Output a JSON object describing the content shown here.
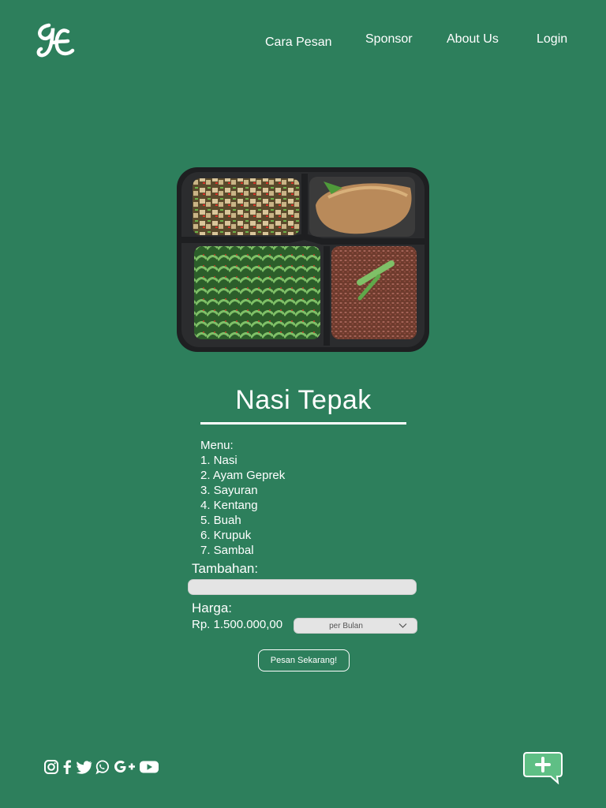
{
  "nav": {
    "items": [
      {
        "label": "Cara Pesan"
      },
      {
        "label": "Sponsor"
      },
      {
        "label": "About Us"
      },
      {
        "label": "Login"
      }
    ]
  },
  "product": {
    "title": "Nasi Tepak",
    "menu_heading": "Menu:",
    "menu_items": [
      "1. Nasi",
      "2. Ayam Geprek",
      "3. Sayuran",
      "4. Kentang",
      "5. Buah",
      "6. Krupuk",
      "7. Sambal"
    ],
    "extras_label": "Tambahan:",
    "extras_value": "",
    "price_label": "Harga:",
    "price_value": "Rp. 1.500.000,00",
    "period_selected": "per Bulan",
    "order_button": "Pesan Sekarang!"
  },
  "footer": {
    "social_icons": [
      "instagram-icon",
      "facebook-icon",
      "twitter-icon",
      "whatsapp-icon",
      "google-plus-icon",
      "youtube-icon"
    ],
    "chat_icon": "chat-add-icon"
  },
  "colors": {
    "background": "#2d7f5c",
    "text": "#ffffff",
    "input_bg": "#e4e4e4",
    "chat_accent": "#5fbf85"
  }
}
